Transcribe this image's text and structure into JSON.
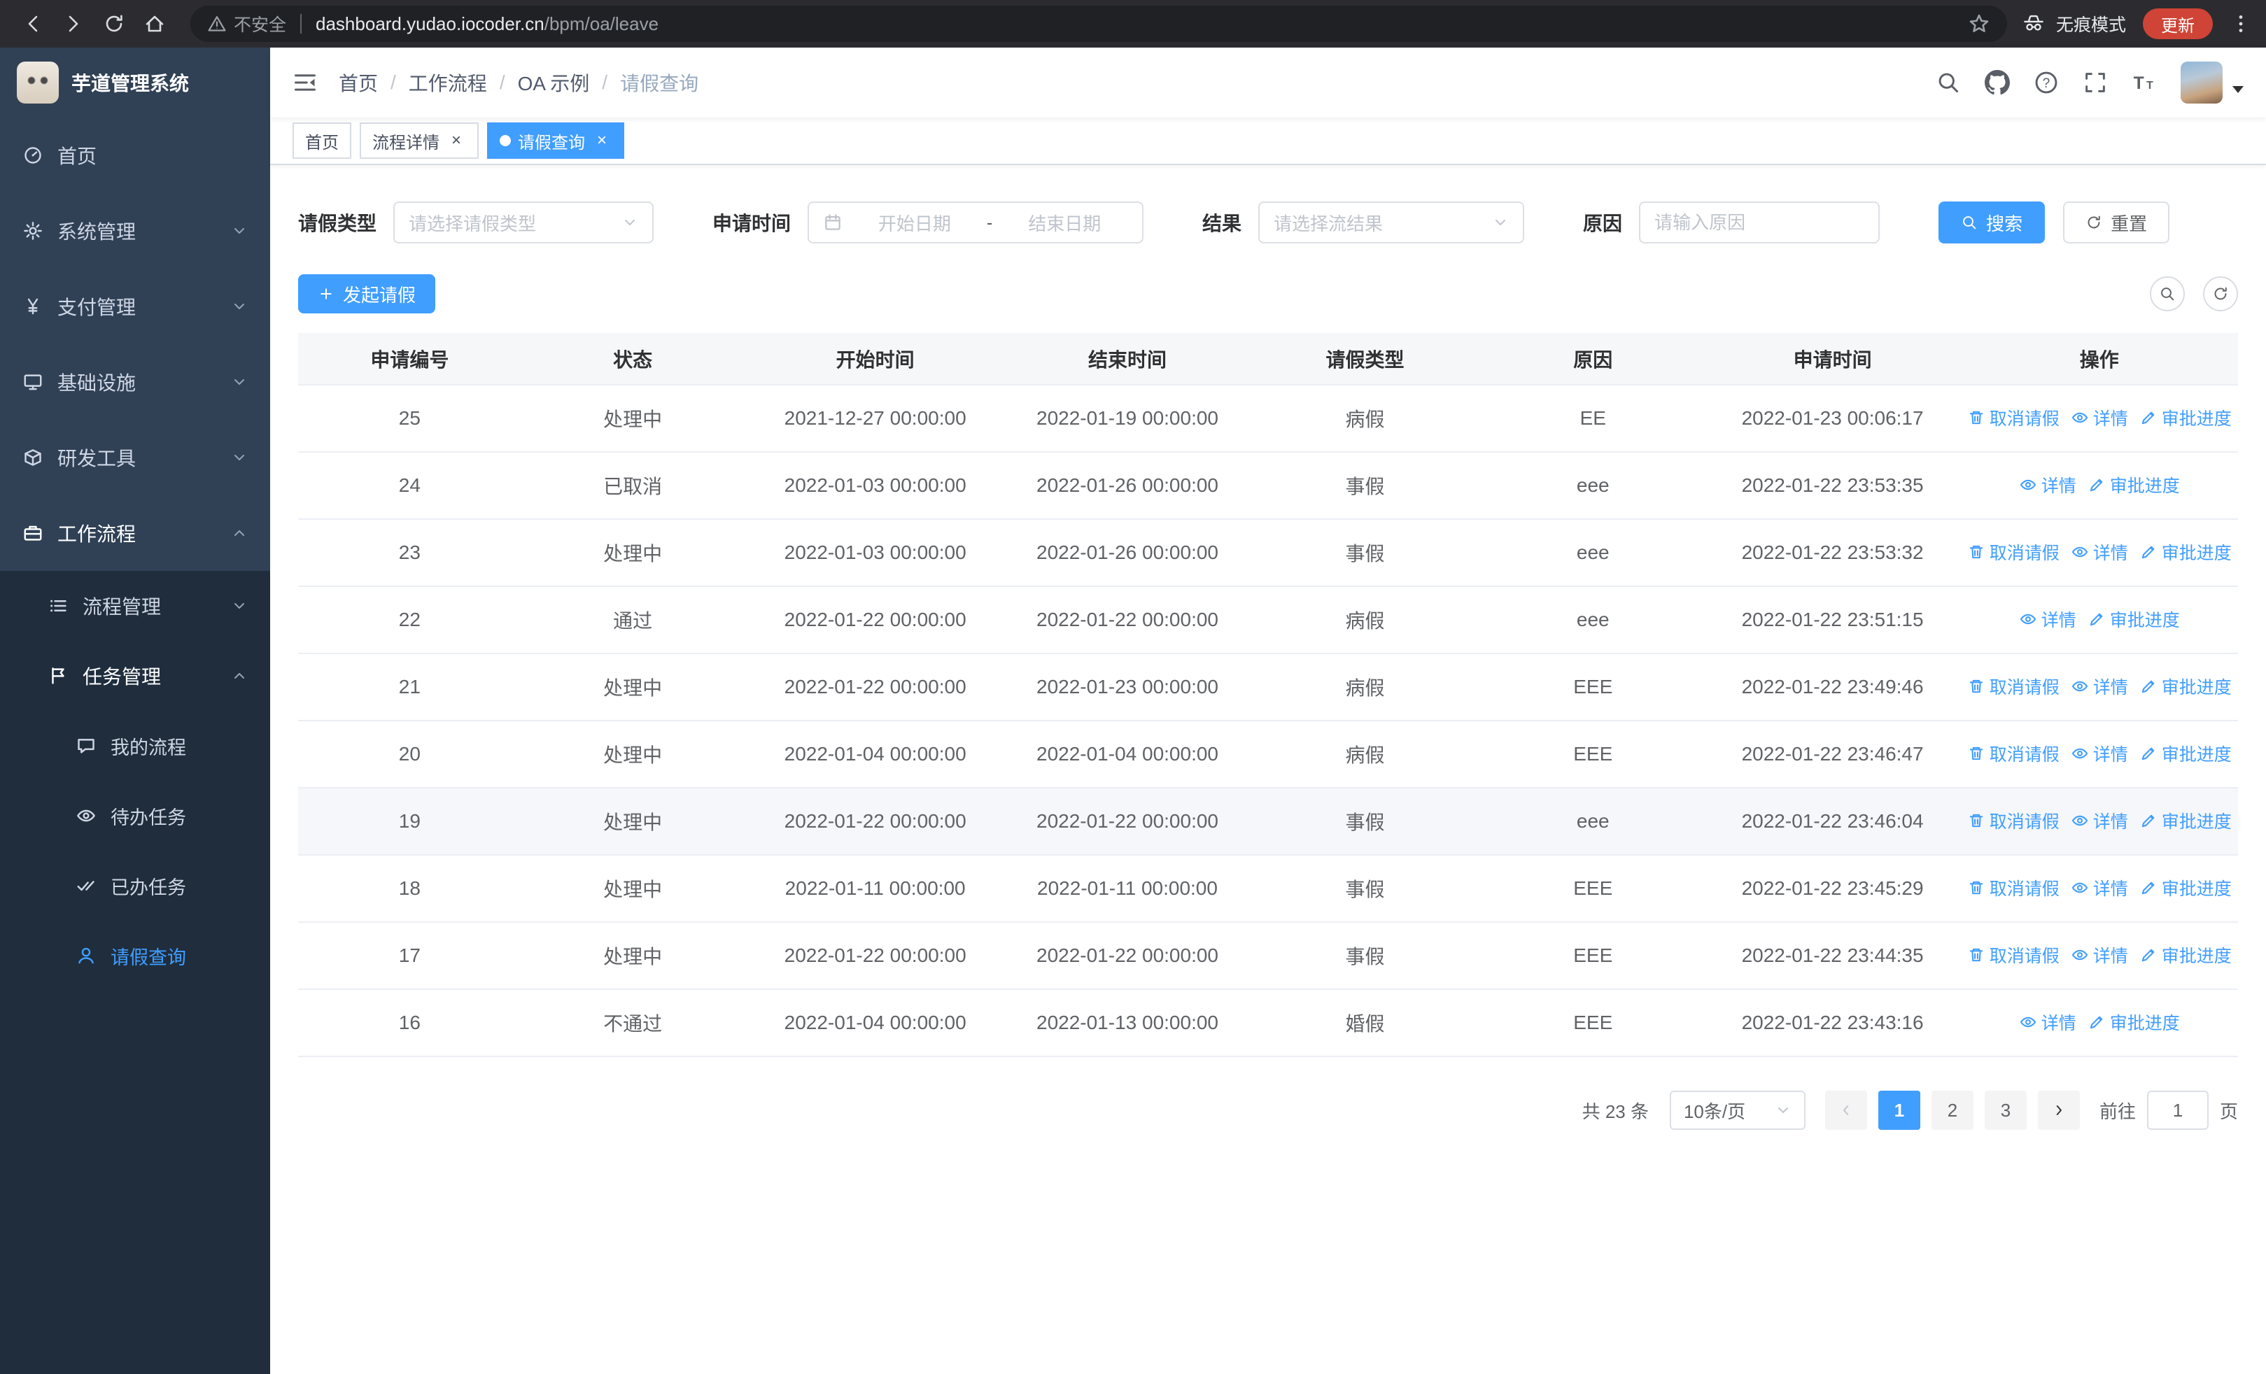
{
  "browser": {
    "security_warning": "不安全",
    "url_domain": "dashboard.yudao.iocoder.cn",
    "url_path": "/bpm/oa/leave",
    "incognito_label": "无痕模式",
    "update_button": "更新"
  },
  "sidebar": {
    "logo_title": "芋道管理系统",
    "items": [
      {
        "label": "首页"
      },
      {
        "label": "系统管理"
      },
      {
        "label": "支付管理"
      },
      {
        "label": "基础设施"
      },
      {
        "label": "研发工具"
      },
      {
        "label": "工作流程"
      },
      {
        "label": "流程管理"
      },
      {
        "label": "任务管理"
      },
      {
        "label": "我的流程"
      },
      {
        "label": "待办任务"
      },
      {
        "label": "已办任务"
      },
      {
        "label": "请假查询"
      }
    ]
  },
  "header": {
    "breadcrumb": [
      "首页",
      "工作流程",
      "OA 示例",
      "请假查询"
    ],
    "separator": "/"
  },
  "tabs": [
    {
      "label": "首页"
    },
    {
      "label": "流程详情"
    },
    {
      "label": "请假查询"
    }
  ],
  "filters": {
    "leave_type_label": "请假类型",
    "leave_type_placeholder": "请选择请假类型",
    "apply_time_label": "申请时间",
    "start_date_placeholder": "开始日期",
    "date_separator": "-",
    "end_date_placeholder": "结束日期",
    "result_label": "结果",
    "result_placeholder": "请选择流结果",
    "reason_label": "原因",
    "reason_placeholder": "请输入原因",
    "search_button": "搜索",
    "reset_button": "重置"
  },
  "toolbar": {
    "create_button": "发起请假"
  },
  "table": {
    "columns": [
      "申请编号",
      "状态",
      "开始时间",
      "结束时间",
      "请假类型",
      "原因",
      "申请时间",
      "操作"
    ],
    "action_labels": {
      "cancel": "取消请假",
      "detail": "详情",
      "progress": "审批进度"
    },
    "rows": [
      {
        "id": "25",
        "status": "处理中",
        "start": "2021-12-27 00:00:00",
        "end": "2022-01-19 00:00:00",
        "type": "病假",
        "reason": "EE",
        "applyTime": "2022-01-23 00:06:17",
        "actions": [
          "cancel",
          "detail",
          "progress"
        ],
        "highlight": false
      },
      {
        "id": "24",
        "status": "已取消",
        "start": "2022-01-03 00:00:00",
        "end": "2022-01-26 00:00:00",
        "type": "事假",
        "reason": "eee",
        "applyTime": "2022-01-22 23:53:35",
        "actions": [
          "detail",
          "progress"
        ],
        "highlight": false
      },
      {
        "id": "23",
        "status": "处理中",
        "start": "2022-01-03 00:00:00",
        "end": "2022-01-26 00:00:00",
        "type": "事假",
        "reason": "eee",
        "applyTime": "2022-01-22 23:53:32",
        "actions": [
          "cancel",
          "detail",
          "progress"
        ],
        "highlight": false
      },
      {
        "id": "22",
        "status": "通过",
        "start": "2022-01-22 00:00:00",
        "end": "2022-01-22 00:00:00",
        "type": "病假",
        "reason": "eee",
        "applyTime": "2022-01-22 23:51:15",
        "actions": [
          "detail",
          "progress"
        ],
        "highlight": false
      },
      {
        "id": "21",
        "status": "处理中",
        "start": "2022-01-22 00:00:00",
        "end": "2022-01-23 00:00:00",
        "type": "病假",
        "reason": "EEE",
        "applyTime": "2022-01-22 23:49:46",
        "actions": [
          "cancel",
          "detail",
          "progress"
        ],
        "highlight": false
      },
      {
        "id": "20",
        "status": "处理中",
        "start": "2022-01-04 00:00:00",
        "end": "2022-01-04 00:00:00",
        "type": "病假",
        "reason": "EEE",
        "applyTime": "2022-01-22 23:46:47",
        "actions": [
          "cancel",
          "detail",
          "progress"
        ],
        "highlight": false
      },
      {
        "id": "19",
        "status": "处理中",
        "start": "2022-01-22 00:00:00",
        "end": "2022-01-22 00:00:00",
        "type": "事假",
        "reason": "eee",
        "applyTime": "2022-01-22 23:46:04",
        "actions": [
          "cancel",
          "detail",
          "progress"
        ],
        "highlight": true
      },
      {
        "id": "18",
        "status": "处理中",
        "start": "2022-01-11 00:00:00",
        "end": "2022-01-11 00:00:00",
        "type": "事假",
        "reason": "EEE",
        "applyTime": "2022-01-22 23:45:29",
        "actions": [
          "cancel",
          "detail",
          "progress"
        ],
        "highlight": false
      },
      {
        "id": "17",
        "status": "处理中",
        "start": "2022-01-22 00:00:00",
        "end": "2022-01-22 00:00:00",
        "type": "事假",
        "reason": "EEE",
        "applyTime": "2022-01-22 23:44:35",
        "actions": [
          "cancel",
          "detail",
          "progress"
        ],
        "highlight": false
      },
      {
        "id": "16",
        "status": "不通过",
        "start": "2022-01-04 00:00:00",
        "end": "2022-01-13 00:00:00",
        "type": "婚假",
        "reason": "EEE",
        "applyTime": "2022-01-22 23:43:16",
        "actions": [
          "detail",
          "progress"
        ],
        "highlight": false
      }
    ]
  },
  "pagination": {
    "total_text": "共 23 条",
    "page_size": "10条/页",
    "pages": [
      "1",
      "2",
      "3"
    ],
    "active_page": "1",
    "goto_label": "前往",
    "goto_value": "1",
    "goto_suffix": "页"
  },
  "colors": {
    "accent": "#409eff",
    "sidebar_bg": "#304156",
    "sidebar_submenu_bg": "#1f2d3d"
  }
}
